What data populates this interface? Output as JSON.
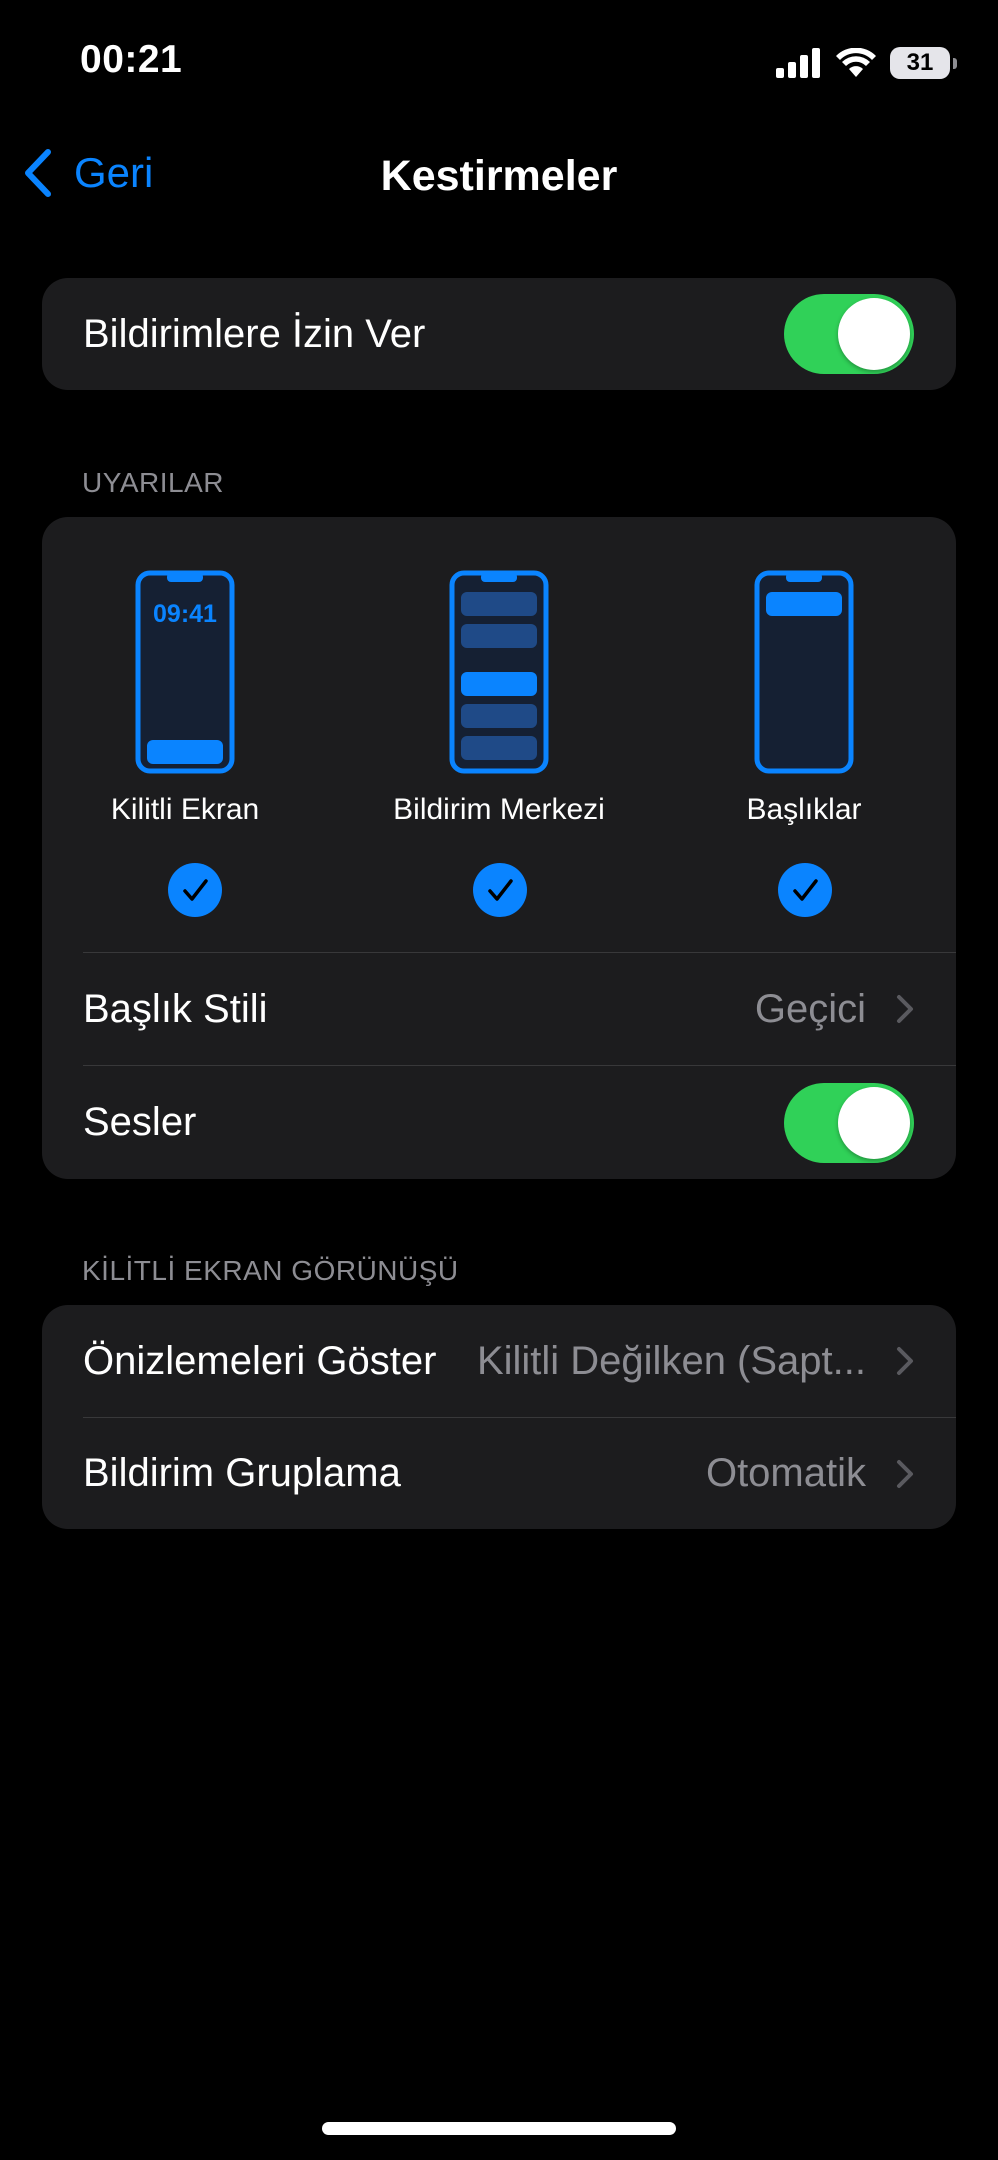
{
  "status_bar": {
    "time": "00:21",
    "battery": "31"
  },
  "nav": {
    "back_label": "Geri",
    "title": "Kestirmeler"
  },
  "allow_notifications": {
    "label": "Bildirimlere İzin Ver",
    "enabled": true
  },
  "alerts": {
    "header": "UYARILAR",
    "options": [
      {
        "label": "Kilitli Ekran",
        "preview_time": "09:41",
        "checked": true
      },
      {
        "label": "Bildirim Merkezi",
        "checked": true
      },
      {
        "label": "Başlıklar",
        "checked": true
      }
    ],
    "banner_style": {
      "label": "Başlık Stili",
      "value": "Geçici"
    },
    "sounds": {
      "label": "Sesler",
      "enabled": true
    }
  },
  "lock_screen": {
    "header": "KİLİTLİ EKRAN GÖRÜNÜŞÜ",
    "show_previews": {
      "label": "Önizlemeleri Göster",
      "value": "Kilitli Değilken (Sapt..."
    },
    "grouping": {
      "label": "Bildirim Gruplama",
      "value": "Otomatik"
    }
  },
  "colors": {
    "accent": "#0a84ff",
    "toggle_on": "#30d158",
    "card": "#1c1c1e",
    "secondary_text": "#8d8d93"
  }
}
